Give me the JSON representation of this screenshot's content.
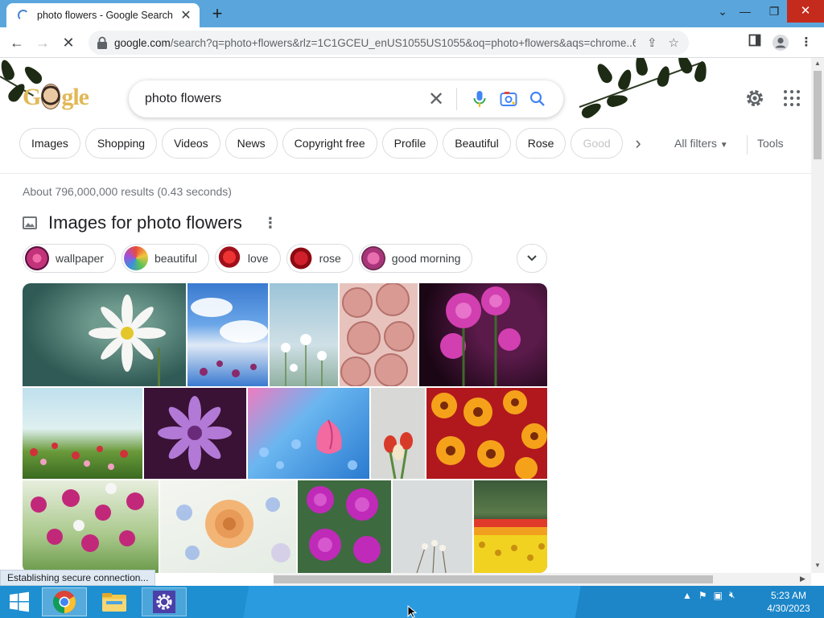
{
  "browser": {
    "tab_title": "photo flowers - Google Search",
    "new_tab": "+",
    "url_domain": "google.com",
    "url_rest": "/search?q=photo+flowers&rlz=1C1GCEU_enUS1055US1055&oq=photo+flowers&aqs=chrome..69i5...",
    "status_text": "Establishing secure connection..."
  },
  "search": {
    "logo_text_left": "G",
    "logo_text_right": "gle",
    "query": "photo flowers",
    "clear_glyph": "✕"
  },
  "filters": {
    "chips": [
      "Images",
      "Shopping",
      "Videos",
      "News",
      "Copyright free",
      "Profile",
      "Beautiful",
      "Rose",
      "Good"
    ],
    "all_filters": "All filters",
    "tools": "Tools"
  },
  "results": {
    "stats": "About 796,000,000 results (0.43 seconds)",
    "images_title": "Images for photo flowers",
    "refine_chips": [
      {
        "label": "wallpaper",
        "color": "#c2337a"
      },
      {
        "label": "beautiful",
        "color": "#e8a33a"
      },
      {
        "label": "love",
        "color": "#c0151f"
      },
      {
        "label": "rose",
        "color": "#b0101a"
      },
      {
        "label": "good morning",
        "color": "#a8357a"
      }
    ]
  },
  "taskbar": {
    "time": "5:23 AM",
    "date": "4/30/2023"
  },
  "colors": {
    "accent": "#1a73e8",
    "titlebar": "#5aa6dc",
    "close_red": "#c42b1c",
    "taskbar": "#1e8fd0"
  }
}
